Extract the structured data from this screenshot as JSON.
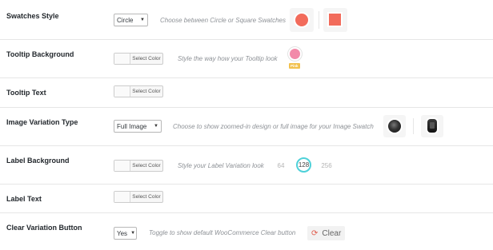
{
  "rows": [
    {
      "label": "Swatches Style",
      "select_value": "Circle",
      "description": "Choose between Circle or Square Swatches"
    },
    {
      "label": "Tooltip Background",
      "button": "Select Color",
      "description": "Style the way how your Tooltip look",
      "tooltip_badge": "Pink"
    },
    {
      "label": "Tooltip Text",
      "button": "Select Color"
    },
    {
      "label": "Image Variation Type",
      "select_value": "Full Image",
      "description": "Choose to show zoomed-in design or full image for your Image Swatch"
    },
    {
      "label": "Label Background",
      "button": "Select Color",
      "description": "Style your Label Variation look",
      "label_values": [
        "64",
        "128",
        "256"
      ]
    },
    {
      "label": "Label Text",
      "button": "Select Color"
    },
    {
      "label": "Clear Variation Button",
      "select_value": "Yes",
      "description": "Toggle to show default WooCommerce Clear button",
      "clear_label": "Clear"
    }
  ],
  "colors": {
    "swatch": "#f26b5b",
    "tooltip_dot": "#f28aa9",
    "tooltip_badge": "#f2c14e",
    "label_active_ring": "#4fd1d9",
    "clear_icon": "#e05a4a"
  },
  "icons": {
    "caret": "chevron-down-icon",
    "clear": "refresh-icon"
  }
}
